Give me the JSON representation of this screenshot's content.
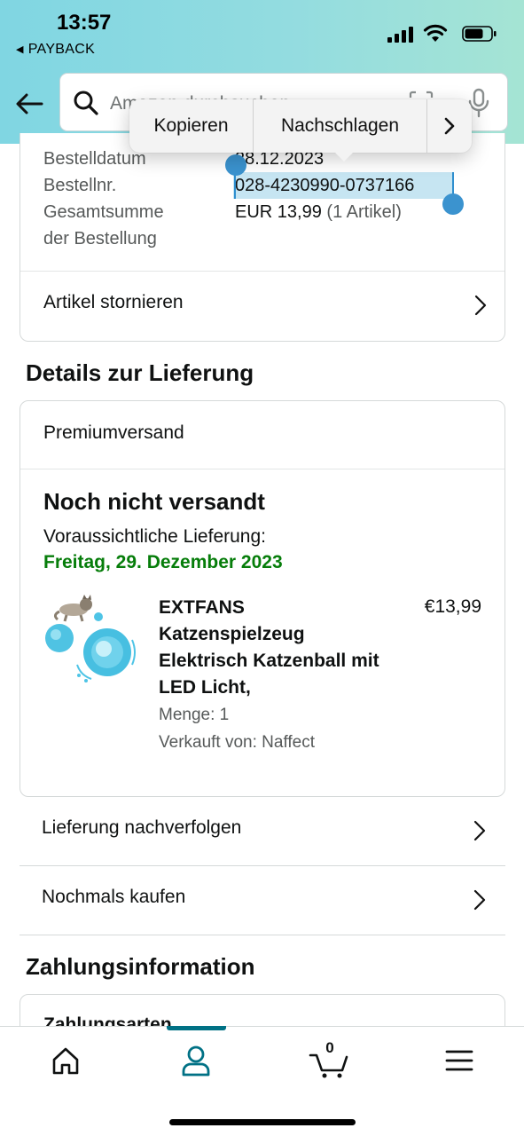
{
  "status_bar": {
    "time": "13:57",
    "back_app": "PAYBACK"
  },
  "header": {
    "search_placeholder": "Amazon durchsuchen"
  },
  "context_menu": {
    "items": [
      "Kopieren",
      "Nachschlagen"
    ]
  },
  "order": {
    "date_label": "Bestelldatum",
    "date_value": "28.12.2023",
    "number_label": "Bestellnr.",
    "number_value": "028-4230990-0737166",
    "total_label_line1": "Gesamtsumme",
    "total_label_line2": "der Bestellung",
    "total_value": "EUR 13,99",
    "total_items": "(1 Artikel)",
    "cancel_label": "Artikel stornieren"
  },
  "delivery": {
    "section_title": "Details zur Lieferung",
    "shipping_type": "Premiumversand",
    "status": "Noch nicht versandt",
    "estimate_label": "Voraussichtliche Lieferung:",
    "estimate_date": "Freitag, 29. Dezember 2023",
    "product": {
      "title": "EXTFANS Katzenspielzeug Elektrisch Katzenball mit LED Licht,",
      "price": "€13,99",
      "quantity": "Menge: 1",
      "seller": "Verkauft von: Naffect"
    },
    "track_label": "Lieferung nachverfolgen",
    "buy_again_label": "Nochmals kaufen"
  },
  "payment": {
    "section_title": "Zahlungsinformation",
    "methods_label": "Zahlungsarten"
  },
  "bottom_nav": {
    "items": [
      "home-icon",
      "account-icon",
      "cart-icon",
      "menu-icon"
    ],
    "cart_count": "0",
    "active": "account-icon"
  },
  "colors": {
    "header_gradient_start": "#80d6e2",
    "header_gradient_end": "#a5e4d4",
    "delivery_green": "#067d0a",
    "selection_blue": "#c6e5f2",
    "active_nav": "#007185"
  }
}
